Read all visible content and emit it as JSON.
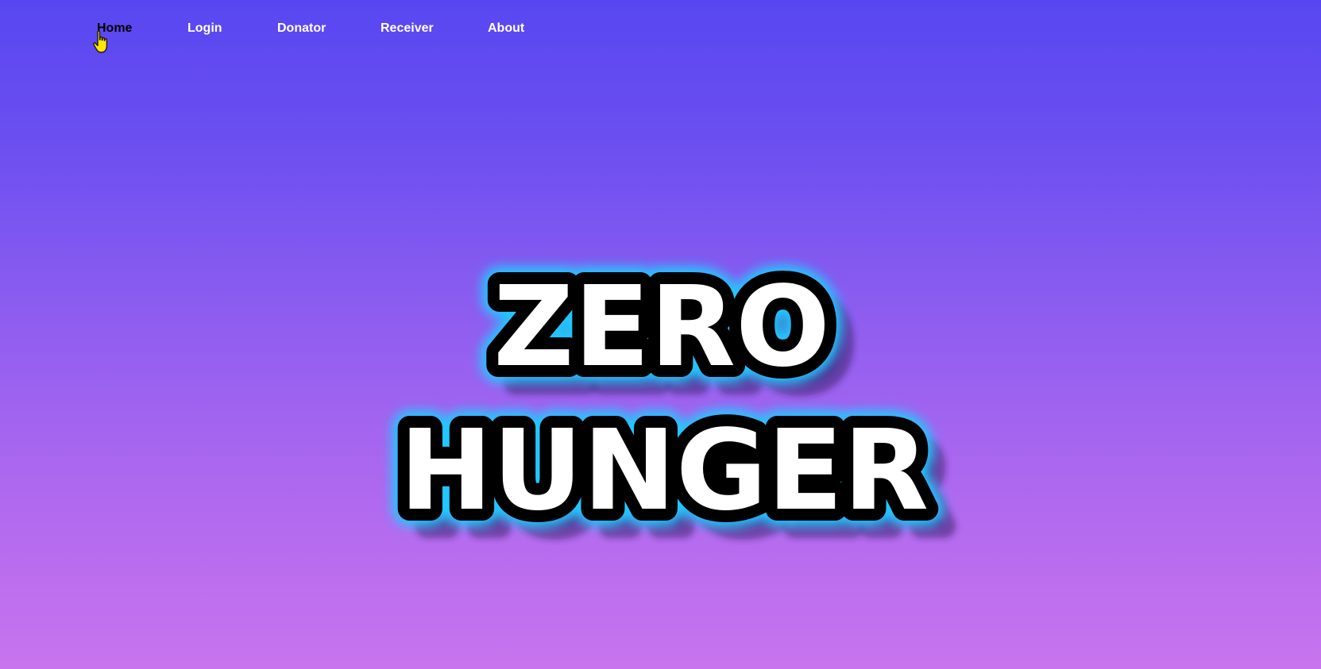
{
  "nav": {
    "items": [
      {
        "label": "Home",
        "active": true
      },
      {
        "label": "Login",
        "active": false
      },
      {
        "label": "Donator",
        "active": false
      },
      {
        "label": "Receiver",
        "active": false
      },
      {
        "label": "About",
        "active": false
      }
    ]
  },
  "hero": {
    "line1": "ZERO",
    "line2": "HUNGER",
    "glow_color": "#22c7ff",
    "outline_color": "#000000",
    "fill_color": "#ffffff"
  },
  "theme": {
    "gradient_top": "#5847f1",
    "gradient_bottom": "#c874ee"
  }
}
